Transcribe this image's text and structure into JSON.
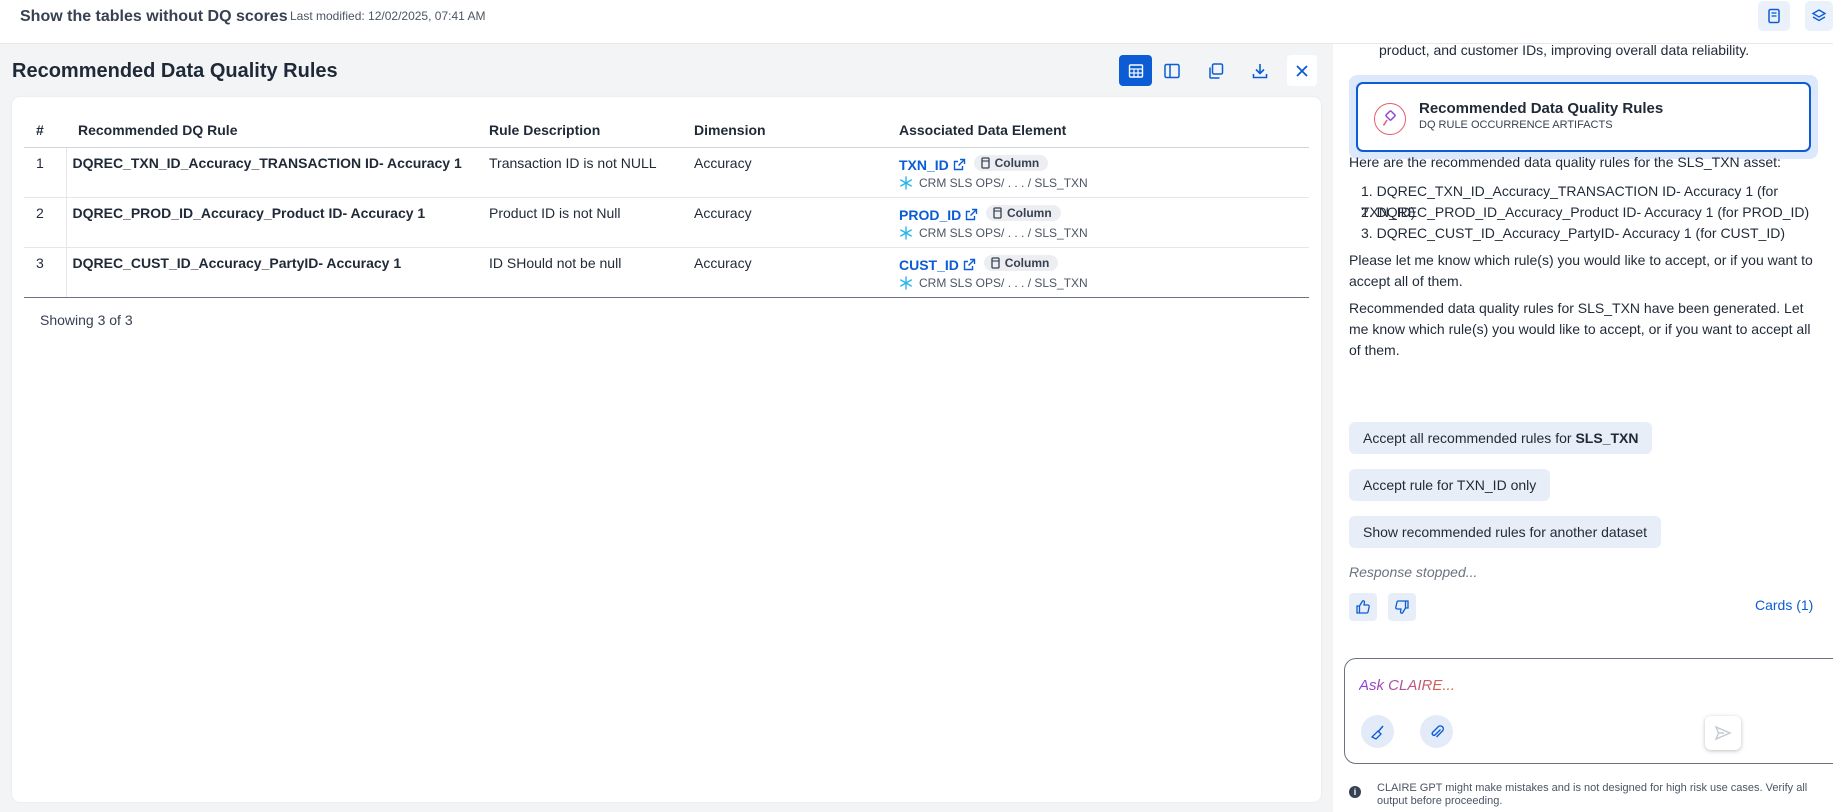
{
  "header": {
    "title": "Show the tables without DQ scores",
    "last_modified": "Last modified: 12/02/2025, 07:41 AM"
  },
  "panel": {
    "title": "Recommended Data Quality Rules",
    "toolbar": [
      "table-view-icon",
      "split-view-icon",
      "copy-icon",
      "download-icon",
      "close-icon"
    ],
    "table": {
      "columns": [
        "#",
        "Recommended DQ Rule",
        "Rule Description",
        "Dimension",
        "Associated Data Element"
      ],
      "rows": [
        {
          "num": "1",
          "rule": "DQREC_TXN_ID_Accuracy_TRANSACTION ID- Accuracy 1",
          "description": "Transaction ID is not NULL",
          "dimension": "Accuracy",
          "element": "TXN_ID",
          "chip": "Column",
          "path": "CRM SLS OPS/ . . . / SLS_TXN"
        },
        {
          "num": "2",
          "rule": "DQREC_PROD_ID_Accuracy_Product ID- Accuracy 1",
          "description": "Product ID is not Null",
          "dimension": "Accuracy",
          "element": "PROD_ID",
          "chip": "Column",
          "path": "CRM SLS OPS/ . . . / SLS_TXN"
        },
        {
          "num": "3",
          "rule": "DQREC_CUST_ID_Accuracy_PartyID- Accuracy 1",
          "description": "ID SHould not be null",
          "dimension": "Accuracy",
          "element": "CUST_ID",
          "chip": "Column",
          "path": "CRM SLS OPS/ . . . / SLS_TXN"
        }
      ]
    },
    "showing": "Showing 3 of 3"
  },
  "chat": {
    "top_text": "product, and customer IDs, improving overall data reliability.",
    "artifact": {
      "title": "Recommended Data Quality Rules",
      "subtitle": "DQ RULE OCCURRENCE ARTIFACTS"
    },
    "intro": "Here are the recommended data quality rules for the SLS_TXN asset:",
    "list": [
      "DQREC_TXN_ID_Accuracy_TRANSACTION ID- Accuracy 1 (for TXN_ID)",
      "DQREC_PROD_ID_Accuracy_Product ID- Accuracy 1 (for PROD_ID)",
      "DQREC_CUST_ID_Accuracy_PartyID- Accuracy 1 (for CUST_ID)"
    ],
    "list_markers": [
      "1.",
      "2.",
      "3."
    ],
    "para1": "Please let me know which rule(s) you would like to accept, or if you want to accept all of them.",
    "para2": "Recommended data quality rules for SLS_TXN have been generated. Let me know which rule(s) you would like to accept, or if you want to accept all of them.",
    "suggestions": {
      "accept_all_prefix": "Accept all recommended rules for",
      "accept_all_bold": "SLS_TXN",
      "accept_one": "Accept rule for TXN_ID only",
      "show_other": "Show recommended rules for another dataset"
    },
    "stopped": "Response stopped...",
    "cards": "Cards (1)",
    "input_placeholder": "Ask CLAIRE...",
    "disclaimer": "CLAIRE GPT might make mistakes and is not designed for high risk use cases. Verify all output before proceeding."
  },
  "colors": {
    "accent": "#0b5cd5",
    "snowflake": "#29b5e8"
  }
}
